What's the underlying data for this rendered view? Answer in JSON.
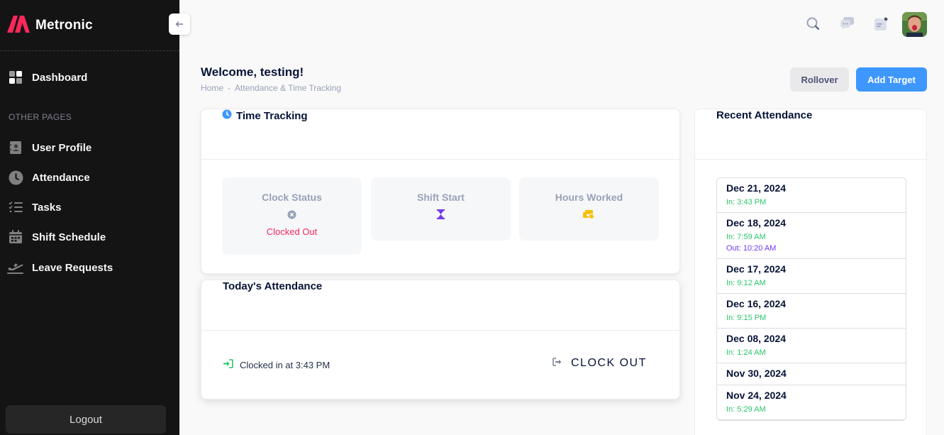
{
  "app": {
    "name": "Metronic"
  },
  "sidebar": {
    "primary": {
      "label": "Dashboard"
    },
    "section_label": "OTHER PAGES",
    "items": [
      {
        "label": "User Profile",
        "icon": "user-profile-icon"
      },
      {
        "label": "Attendance",
        "icon": "clock-icon"
      },
      {
        "label": "Tasks",
        "icon": "tasks-list-icon"
      },
      {
        "label": "Shift Schedule",
        "icon": "calendar-icon"
      },
      {
        "label": "Leave Requests",
        "icon": "airplane-icon"
      }
    ],
    "logout_label": "Logout"
  },
  "header": {
    "icons": [
      "search-icon",
      "chat-icon",
      "notification-icon"
    ]
  },
  "page": {
    "title": "Welcome, testing!",
    "breadcrumb": [
      "Home",
      "-",
      "Attendance & Time Tracking"
    ],
    "rollover_label": "Rollover",
    "add_target_label": "Add Target"
  },
  "time_tracking": {
    "title": "Time Tracking",
    "stats": [
      {
        "label": "Clock Status",
        "value": "Clocked Out",
        "icon": "x-circle-icon"
      },
      {
        "label": "Shift Start",
        "value": "",
        "icon": "hourglass-icon"
      },
      {
        "label": "Hours Worked",
        "value": "",
        "icon": "money-icon"
      }
    ]
  },
  "today": {
    "title": "Today's Attendance",
    "clocked_in_text": "Clocked in at 3:43 PM",
    "clock_out_label": "CLOCK OUT"
  },
  "recent": {
    "title": "Recent Attendance",
    "entries": [
      {
        "date": "Dec 21, 2024",
        "in": "In: 3:43 PM",
        "out": ""
      },
      {
        "date": "Dec 18, 2024",
        "in": "In: 7:59 AM",
        "out": "Out: 10:20 AM"
      },
      {
        "date": "Dec 17, 2024",
        "in": "In: 9:12 AM",
        "out": ""
      },
      {
        "date": "Dec 16, 2024",
        "in": "In: 9:15 PM",
        "out": ""
      },
      {
        "date": "Dec 08, 2024",
        "in": "In: 1:24 AM",
        "out": ""
      },
      {
        "date": "Nov 30, 2024",
        "in": "",
        "out": ""
      },
      {
        "date": "Nov 24, 2024",
        "in": "In: 5:29 AM",
        "out": ""
      }
    ]
  },
  "colors": {
    "sidebar_bg": "#141414",
    "accent_blue": "#3e97ff",
    "danger": "#f8285a",
    "success": "#2bc56b",
    "purple": "#7239ea",
    "warning": "#f6c000"
  }
}
